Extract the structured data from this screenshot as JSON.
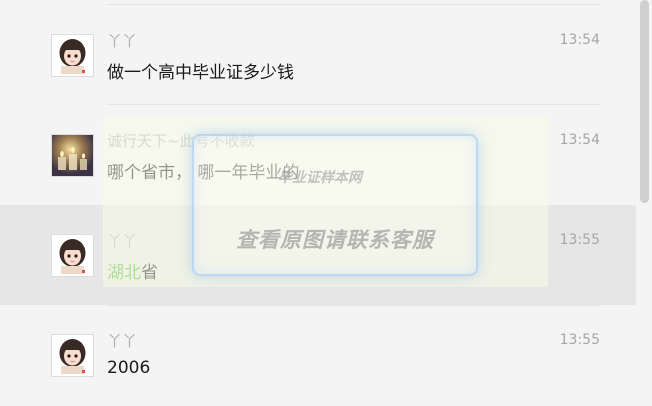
{
  "messages": [
    {
      "sender": "丫丫",
      "time": "13:54",
      "text": "做一个高中毕业证多少钱"
    },
    {
      "sender": "诚行天下~此号不收款",
      "time": "13:54",
      "text": "哪个省市， 哪一年毕业的"
    },
    {
      "sender": "丫丫",
      "time": "13:55",
      "text_highlight": "湖北",
      "text_rest": "省"
    },
    {
      "sender": "丫丫",
      "time": "13:55",
      "text": "2006"
    }
  ],
  "watermark": {
    "small": "毕业证样本网",
    "big": "查看原图请联系客服"
  },
  "colors": {
    "background": "#f4f4f4",
    "selected_row": "#e6e6e6",
    "highlight_text": "#4fbf3a",
    "sender_text": "#b0b0b0"
  },
  "icons": [
    "girl-avatar-icon",
    "candle-avatar-icon"
  ]
}
